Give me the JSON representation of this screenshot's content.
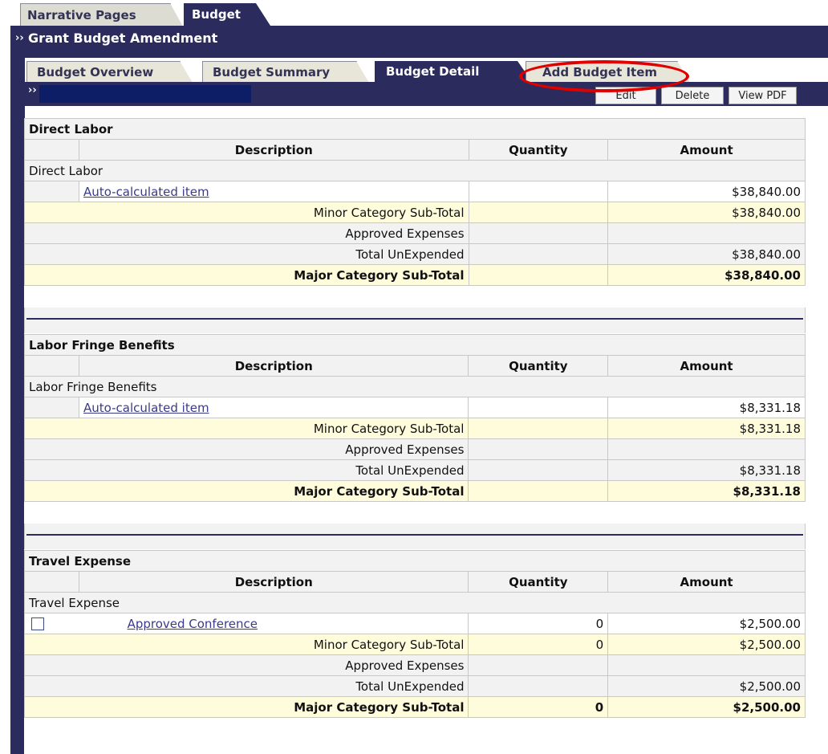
{
  "top_tabs": [
    {
      "label": "Narrative Pages",
      "active": false
    },
    {
      "label": "Budget",
      "active": true
    }
  ],
  "frame_title": "Grant Budget Amendment",
  "sub_tabs": [
    {
      "label": "Budget Overview",
      "active": false
    },
    {
      "label": "Budget Summary",
      "active": false
    },
    {
      "label": "Budget Detail",
      "active": true
    },
    {
      "label": "Add Budget Item",
      "active": false,
      "highlighted": true
    }
  ],
  "toolbar": {
    "edit": "Edit",
    "delete": "Delete",
    "view_pdf": "View PDF"
  },
  "columns": {
    "description": "Description",
    "quantity": "Quantity",
    "amount": "Amount"
  },
  "sections": [
    {
      "title": "Direct Labor",
      "category": "Direct Labor",
      "item": {
        "label": "Auto-calculated item",
        "quantity": "",
        "amount": "$38,840.00"
      },
      "minor_label": "Minor Category Sub-Total",
      "minor_qty": "",
      "minor_amount": "$38,840.00",
      "approved_label": "Approved Expenses",
      "unexpended_label": "Total UnExpended",
      "unexpended_amount": "$38,840.00",
      "major_label": "Major Category Sub-Total",
      "major_qty": "",
      "major_amount": "$38,840.00"
    },
    {
      "title": "Labor Fringe Benefits",
      "category": "Labor Fringe Benefits",
      "item": {
        "label": "Auto-calculated item",
        "quantity": "",
        "amount": "$8,331.18"
      },
      "minor_label": "Minor Category Sub-Total",
      "minor_qty": "",
      "minor_amount": "$8,331.18",
      "approved_label": "Approved Expenses",
      "unexpended_label": "Total UnExpended",
      "unexpended_amount": "$8,331.18",
      "major_label": "Major Category Sub-Total",
      "major_qty": "",
      "major_amount": "$8,331.18"
    },
    {
      "title": "Travel Expense",
      "category": "Travel Expense",
      "item": {
        "label": "Approved Conference",
        "quantity": "0",
        "amount": "$2,500.00",
        "has_checkbox": true
      },
      "minor_label": "Minor Category Sub-Total",
      "minor_qty": "0",
      "minor_amount": "$2,500.00",
      "approved_label": "Approved Expenses",
      "unexpended_label": "Total UnExpended",
      "unexpended_amount": "$2,500.00",
      "major_label": "Major Category Sub-Total",
      "major_qty": "0",
      "major_amount": "$2,500.00"
    }
  ],
  "colors": {
    "navy": "#2b2b5e",
    "highlight_ring": "#e00000",
    "subtotal_bg": "#fffcdc",
    "link": "#3a3a8c"
  }
}
